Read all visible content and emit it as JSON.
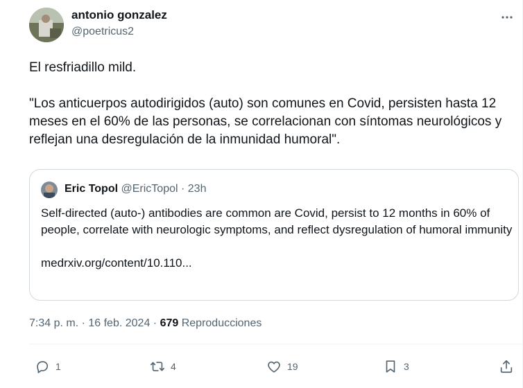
{
  "author": {
    "name": "antonio gonzalez",
    "handle": "@poetricus2"
  },
  "tweet": {
    "line1": "El resfriadillo mild.",
    "line2": "\"Los anticuerpos autodirigidos (auto) son comunes en Covid, persisten hasta 12 meses en el 60% de las personas, se correlacionan con síntomas neurológicos y reflejan una desregulación de la inmunidad humoral\"."
  },
  "quote": {
    "name": "Eric Topol",
    "meta": "@EricTopol · 23h",
    "text": "Self-directed (auto-) antibodies are common are Covid, persist to 12 months in 60% of people, correlate with neurologic symptoms, and reflect dysregulation of humoral immunity",
    "link": "medrxiv.org/content/10.110..."
  },
  "meta": {
    "timestamp": "7:34 p. m. · 16 feb. 2024 · ",
    "views_count": "679",
    "views_label": " Reproducciones"
  },
  "actions": {
    "replies": "1",
    "reposts": "4",
    "likes": "19",
    "bookmarks": "3"
  },
  "icons": {
    "more": "more-dots-icon",
    "reply": "reply-bubble-icon",
    "repost": "repost-arrows-icon",
    "like": "heart-icon",
    "bookmark": "bookmark-icon",
    "share": "share-upload-icon"
  },
  "colors": {
    "text": "#0f1419",
    "secondary": "#536471",
    "border": "#cfd9de",
    "divider": "#eff3f4"
  }
}
